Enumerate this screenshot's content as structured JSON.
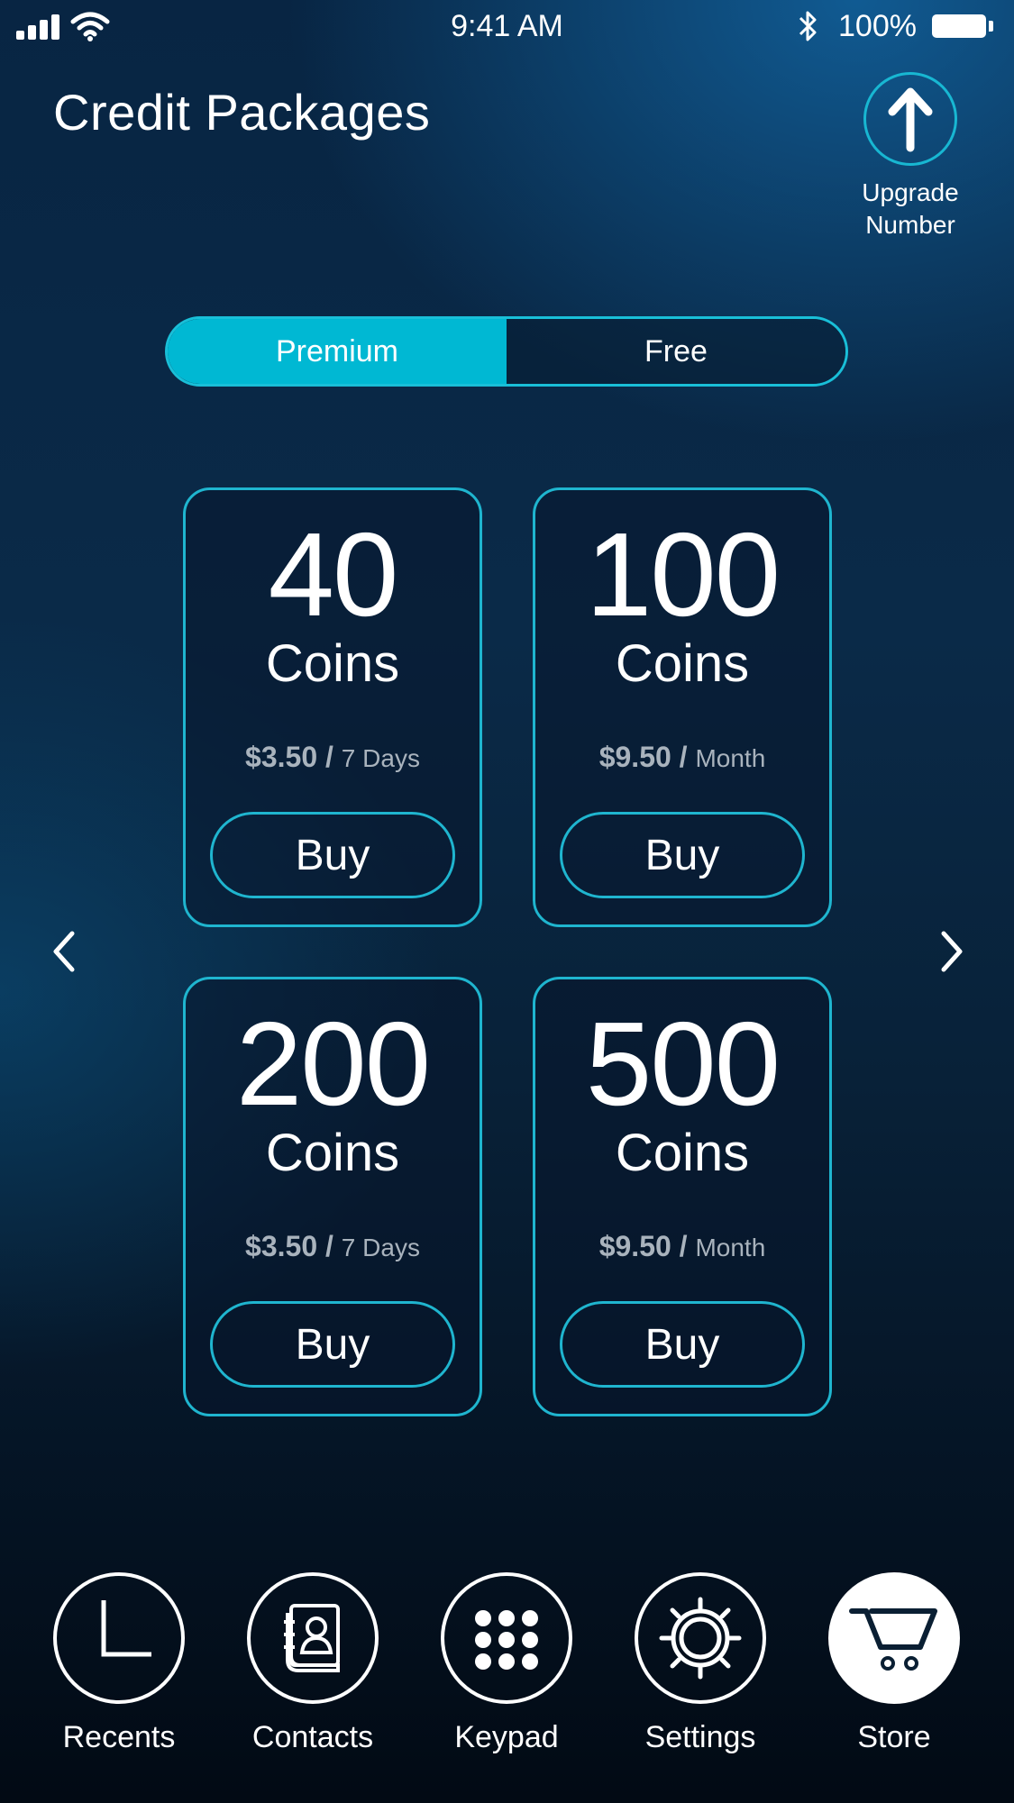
{
  "status_bar": {
    "time": "9:41 AM",
    "battery": "100%",
    "icons": [
      "cellular-signal-icon",
      "wifi-icon",
      "bluetooth-icon",
      "battery-icon"
    ]
  },
  "header": {
    "title": "Credit Packages",
    "upgrade": {
      "label_line1": "Upgrade",
      "label_line2": "Number",
      "icon": "arrow-up-icon"
    }
  },
  "segments": [
    {
      "label": "Premium",
      "active": true
    },
    {
      "label": "Free",
      "active": false
    }
  ],
  "packages": [
    {
      "amount": "40",
      "unit": "Coins",
      "price": "$3.50",
      "separator": "/",
      "period": "7 Days",
      "buy_label": "Buy"
    },
    {
      "amount": "100",
      "unit": "Coins",
      "price": "$9.50",
      "separator": "/",
      "period": "Month",
      "buy_label": "Buy"
    },
    {
      "amount": "200",
      "unit": "Coins",
      "price": "$3.50",
      "separator": "/",
      "period": "7 Days",
      "buy_label": "Buy"
    },
    {
      "amount": "500",
      "unit": "Coins",
      "price": "$9.50",
      "separator": "/",
      "period": "Month",
      "buy_label": "Buy"
    }
  ],
  "pager": {
    "prev_icon": "chevron-left-icon",
    "next_icon": "chevron-right-icon"
  },
  "tabs": [
    {
      "label": "Recents",
      "icon": "clock-icon",
      "active": false
    },
    {
      "label": "Contacts",
      "icon": "contacts-book-icon",
      "active": false
    },
    {
      "label": "Keypad",
      "icon": "keypad-icon",
      "active": false
    },
    {
      "label": "Settings",
      "icon": "gear-icon",
      "active": false
    },
    {
      "label": "Store",
      "icon": "cart-icon",
      "active": true
    }
  ],
  "colors": {
    "accent": "#00b8d3",
    "border": "#1fb5cf",
    "price_text": "#a9b3bd"
  }
}
